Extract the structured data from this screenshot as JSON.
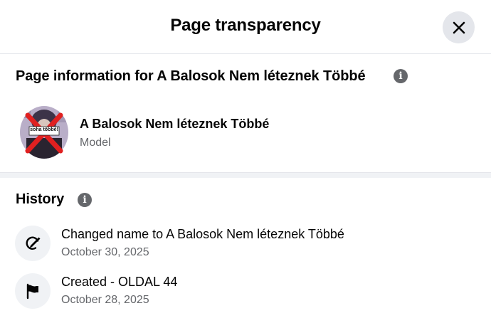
{
  "dialog": {
    "title": "Page transparency",
    "close_icon": "close-icon"
  },
  "page_info": {
    "heading": "Page information for A Balosok Nem léteznek Többé",
    "info_icon": "info-icon",
    "avatar_badge_text": "soha többé!",
    "name": "A Balosok Nem léteznek Többé",
    "category": "Model"
  },
  "history": {
    "heading": "History",
    "info_icon": "info-icon",
    "items": [
      {
        "icon": "rename-icon",
        "title": "Changed name to A Balosok Nem léteznek Többé",
        "date": "October 30, 2025"
      },
      {
        "icon": "flag-icon",
        "title": "Created - OLDAL 44",
        "date": "October 28, 2025"
      }
    ]
  },
  "colors": {
    "primary_text": "#050505",
    "secondary_text": "#65676b",
    "icon_background": "#f0f2f5",
    "close_button_background": "#e4e6eb",
    "avatar_cross": "#e02020"
  }
}
